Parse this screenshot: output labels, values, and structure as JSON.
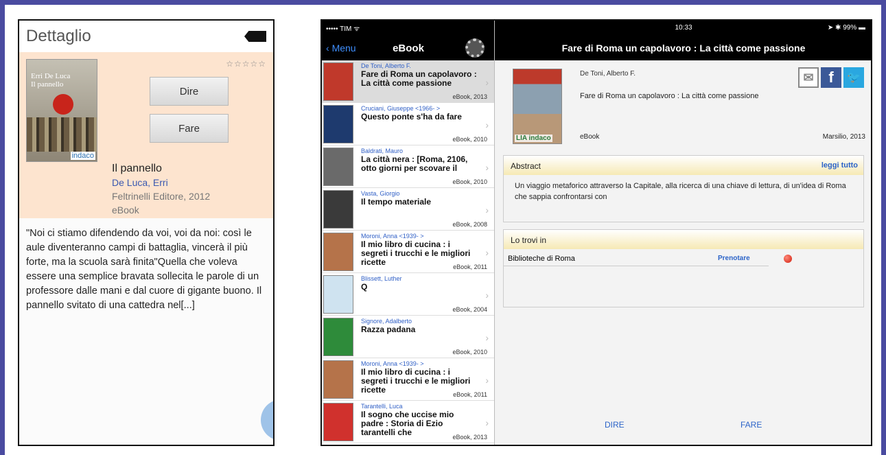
{
  "phone": {
    "header_title": "Dettaglio",
    "stars": "☆☆☆☆☆",
    "cover": {
      "author": "Erri De Luca",
      "title": "Il pannello",
      "logo": "indaco"
    },
    "buttons": {
      "dire": "Dire",
      "fare": "Fare"
    },
    "book": {
      "title": "Il pannello",
      "author": "De Luca, Erri",
      "publisher": "Feltrinelli Editore, 2012",
      "type": "eBook"
    },
    "description": "\"Noi ci stiamo difendendo da voi, voi da noi: così le aule diventeranno campi di battaglia, vincerà il più forte, ma la scuola sarà finita\"Quella che voleva essere una semplice bravata sollecita le parole di un professore dalle mani e dal cuore di gigante buono. Il pannello svitato di una cattedra nel[...]"
  },
  "tablet": {
    "status_left": "••••• TIM ᯤ",
    "status_time": "10:33",
    "status_right": "➤ ✱ 99% ▬",
    "back_label": "Menu",
    "list_title": "eBook",
    "detail_title": "Fare di Roma un capolavoro : La città come passione",
    "list": [
      {
        "author": "De Toni, Alberto F.",
        "title": "Fare di Roma un capolavoro : La città come passione",
        "meta": "eBook, 2013",
        "color": "#c0392b"
      },
      {
        "author": "Cruciani, Giuseppe <1966- >",
        "title": "Questo ponte s'ha da fare",
        "meta": "eBook, 2010",
        "color": "#1e3a6e"
      },
      {
        "author": "Baldrati, Mauro",
        "title": "La città nera : [Roma, 2106, otto giorni per scovare il",
        "meta": "eBook, 2010",
        "color": "#6a6a6a"
      },
      {
        "author": "Vasta, Giorgio",
        "title": "Il tempo materiale",
        "meta": "eBook, 2008",
        "color": "#3a3a3a"
      },
      {
        "author": "Moroni, Anna <1939- >",
        "title": "Il mio libro di cucina : i segreti i trucchi e le migliori ricette",
        "meta": "eBook, 2011",
        "color": "#b5734a"
      },
      {
        "author": "Blissett, Luther",
        "title": "Q",
        "meta": "eBook, 2004",
        "color": "#cfe3f0"
      },
      {
        "author": "Signore, Adalberto",
        "title": "Razza padana",
        "meta": "eBook, 2010",
        "color": "#2e8b3a"
      },
      {
        "author": "Moroni, Anna <1939- >",
        "title": "Il mio libro di cucina : i segreti i trucchi e le migliori ricette",
        "meta": "eBook, 2011",
        "color": "#b5734a"
      },
      {
        "author": "Tarantelli, Luca",
        "title": "Il sogno che uccise mio padre : Storia di Ezio tarantelli che",
        "meta": "eBook, 2013",
        "color": "#d0312d"
      }
    ],
    "detail": {
      "author": "De Toni, Alberto F.",
      "title": "Fare di Roma un capolavoro : La città come passione",
      "type": "eBook",
      "publisher": "Marsilio, 2013",
      "cover_logo": "LIA indaco",
      "abstract_label": "Abstract",
      "read_all": "leggi tutto",
      "abstract_text": "Un viaggio metaforico attraverso la Capitale, alla ricerca di una chiave di lettura, di un'idea di Roma che sappia confrontarsi con",
      "found_label": "Lo trovi in",
      "library": "Biblioteche di Roma",
      "reserve": "Prenotare",
      "dire": "DIRE",
      "fare": "FARE"
    }
  }
}
